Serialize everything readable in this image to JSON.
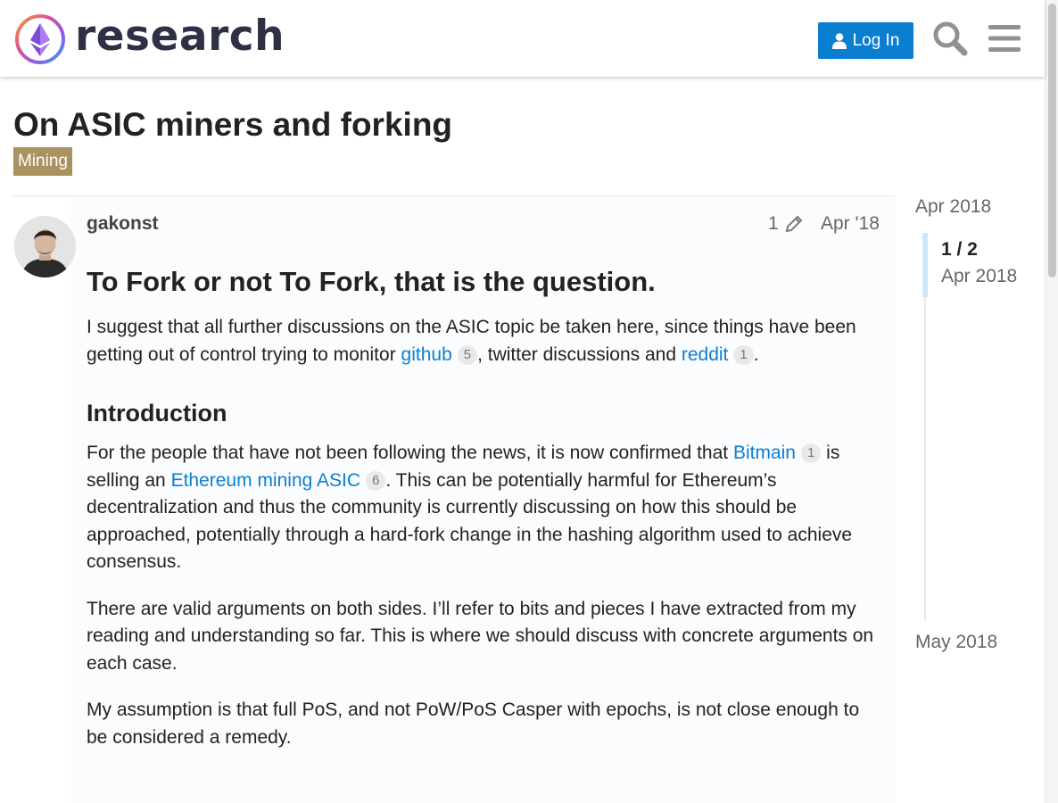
{
  "header": {
    "logo_text": "research",
    "login_label": "Log In"
  },
  "topic": {
    "title": "On ASIC miners and forking",
    "category": "Mining",
    "category_color": "#a9925f"
  },
  "post": {
    "username": "gakonst",
    "edit_count": "1",
    "date": "Apr '18",
    "heading": "To Fork or not To Fork, that is the question.",
    "p1_before": "I suggest that all further discussions on the ASIC topic be taken here, since things have been getting out of control trying to monitor ",
    "p1_link1": "github",
    "p1_link1_clicks": "5",
    "p1_middle": ", twitter discussions and ",
    "p1_link2": "reddit",
    "p1_link2_clicks": "1",
    "p1_end": ".",
    "section_heading": "Introduction",
    "p2_before": "For the people that have not been following the news, it is now confirmed that ",
    "p2_link1": "Bitmain",
    "p2_link1_clicks": "1",
    "p2_middle": " is selling an ",
    "p2_link2": "Ethereum mining ASIC",
    "p2_link2_clicks": "6",
    "p2_end": ". This can be potentially harmful for Ethereum’s decentralization and thus the community is currently discussing on how this should be approached, potentially through a hard-fork change in the hashing algorithm used to achieve consensus.",
    "p3": "There are valid arguments on both sides. I’ll refer to bits and pieces I have extracted from my reading and understanding so far. This is where we should discuss with concrete arguments on each case.",
    "p4": "My assumption is that full PoS, and not PoW/PoS Casper with epochs, is not close enough to be considered a remedy."
  },
  "timeline": {
    "start": "Apr 2018",
    "progress": "1 / 2",
    "progress_date": "Apr 2018",
    "end": "May 2018"
  },
  "colors": {
    "accent": "#0a7fd1",
    "brand_dark": "#2e3146"
  }
}
